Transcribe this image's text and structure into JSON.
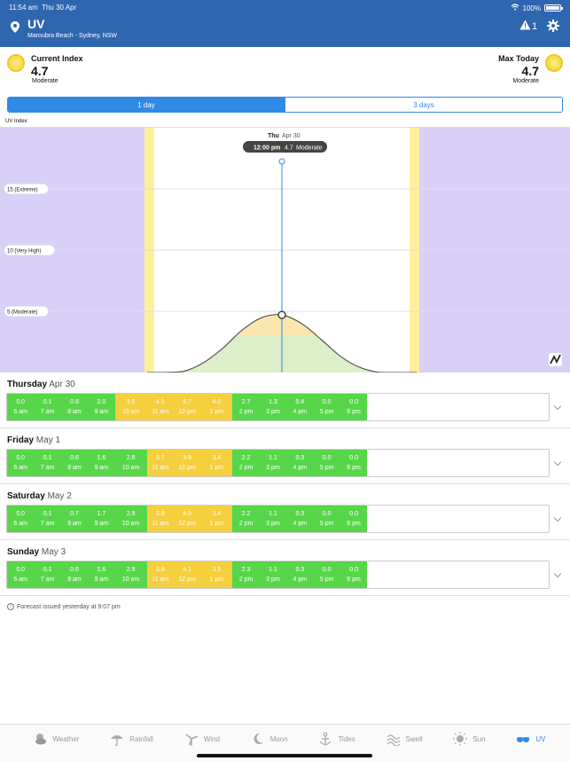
{
  "status": {
    "time": "11:54 am",
    "date": "Thu 30 Apr",
    "battery": "100%"
  },
  "header": {
    "title": "UV",
    "location": "Maroubra Beach - Sydney, NSW",
    "warning_count": "1"
  },
  "summary": {
    "current": {
      "label": "Current Index",
      "value": "4.7",
      "category": "Moderate"
    },
    "max": {
      "label": "Max Today",
      "value": "4.7",
      "category": "Moderate"
    }
  },
  "segments": [
    "1 day",
    "3 days"
  ],
  "chart_data": {
    "type": "area",
    "ylabel": "UV Index",
    "thresholds": [
      {
        "label": "15 (Extreme)",
        "value": 15
      },
      {
        "label": "10 (Very High)",
        "value": 10
      },
      {
        "label": "5 (Moderate)",
        "value": 5
      }
    ],
    "tooltip": {
      "day": "Thu",
      "date": "Apr 30",
      "time": "12:00 pm",
      "value": "4.7",
      "category": "Moderate"
    },
    "ylim": [
      0,
      20
    ],
    "x": [
      6,
      7,
      8,
      9,
      10,
      11,
      12,
      13,
      14,
      15,
      16,
      17,
      18
    ],
    "values": [
      0.0,
      0.1,
      0.8,
      2.0,
      3.5,
      4.5,
      4.7,
      4.0,
      2.7,
      1.3,
      0.4,
      0.0,
      0.0
    ],
    "colors": {
      "night": "#d8d0f7",
      "twilight": "#fef09a",
      "low_fill": "#dcefc8",
      "moderate_fill": "#fbe6b0",
      "line": "#555555",
      "marker": "#2f8ae6"
    }
  },
  "days": [
    {
      "weekday": "Thursday",
      "date": "Apr 30",
      "hours": [
        {
          "v": "0.0",
          "t": "6 am"
        },
        {
          "v": "0.1",
          "t": "7 am"
        },
        {
          "v": "0.8",
          "t": "8 am"
        },
        {
          "v": "2.0",
          "t": "9 am"
        },
        {
          "v": "3.5",
          "t": "10 am"
        },
        {
          "v": "4.5",
          "t": "11 am"
        },
        {
          "v": "4.7",
          "t": "12 pm"
        },
        {
          "v": "4.0",
          "t": "1 pm"
        },
        {
          "v": "2.7",
          "t": "2 pm"
        },
        {
          "v": "1.3",
          "t": "3 pm"
        },
        {
          "v": "0.4",
          "t": "4 pm"
        },
        {
          "v": "0.0",
          "t": "5 pm"
        },
        {
          "v": "0.0",
          "t": "6 pm"
        }
      ]
    },
    {
      "weekday": "Friday",
      "date": "May 1",
      "hours": [
        {
          "v": "0.0",
          "t": "6 am"
        },
        {
          "v": "0.1",
          "t": "7 am"
        },
        {
          "v": "0.6",
          "t": "8 am"
        },
        {
          "v": "1.6",
          "t": "9 am"
        },
        {
          "v": "2.8",
          "t": "10 am"
        },
        {
          "v": "3.7",
          "t": "11 am"
        },
        {
          "v": "3.9",
          "t": "12 pm"
        },
        {
          "v": "3.4",
          "t": "1 pm"
        },
        {
          "v": "2.2",
          "t": "2 pm"
        },
        {
          "v": "1.1",
          "t": "3 pm"
        },
        {
          "v": "0.3",
          "t": "4 pm"
        },
        {
          "v": "0.0",
          "t": "5 pm"
        },
        {
          "v": "0.0",
          "t": "6 pm"
        }
      ]
    },
    {
      "weekday": "Saturday",
      "date": "May 2",
      "hours": [
        {
          "v": "0.0",
          "t": "6 am"
        },
        {
          "v": "0.1",
          "t": "7 am"
        },
        {
          "v": "0.7",
          "t": "8 am"
        },
        {
          "v": "1.7",
          "t": "9 am"
        },
        {
          "v": "2.9",
          "t": "10 am"
        },
        {
          "v": "3.8",
          "t": "11 am"
        },
        {
          "v": "4.0",
          "t": "12 pm"
        },
        {
          "v": "3.4",
          "t": "1 pm"
        },
        {
          "v": "2.2",
          "t": "2 pm"
        },
        {
          "v": "1.1",
          "t": "3 pm"
        },
        {
          "v": "0.3",
          "t": "4 pm"
        },
        {
          "v": "0.0",
          "t": "5 pm"
        },
        {
          "v": "0.0",
          "t": "6 pm"
        }
      ]
    },
    {
      "weekday": "Sunday",
      "date": "May 3",
      "hours": [
        {
          "v": "0.0",
          "t": "6 am"
        },
        {
          "v": "0.1",
          "t": "7 am"
        },
        {
          "v": "0.6",
          "t": "8 am"
        },
        {
          "v": "1.6",
          "t": "9 am"
        },
        {
          "v": "2.9",
          "t": "10 am"
        },
        {
          "v": "3.8",
          "t": "11 am"
        },
        {
          "v": "4.1",
          "t": "12 pm"
        },
        {
          "v": "3.5",
          "t": "1 pm"
        },
        {
          "v": "2.3",
          "t": "2 pm"
        },
        {
          "v": "1.1",
          "t": "3 pm"
        },
        {
          "v": "0.3",
          "t": "4 pm"
        },
        {
          "v": "0.0",
          "t": "5 pm"
        },
        {
          "v": "0.0",
          "t": "6 pm"
        }
      ]
    }
  ],
  "forecast_note": "Forecast issued yesterday at 9:07 pm",
  "tabs": [
    {
      "label": "Weather",
      "icon": "weather-icon"
    },
    {
      "label": "Rainfall",
      "icon": "umbrella-icon"
    },
    {
      "label": "Wind",
      "icon": "wind-turbine-icon"
    },
    {
      "label": "Moon",
      "icon": "moon-icon"
    },
    {
      "label": "Tides",
      "icon": "anchor-icon"
    },
    {
      "label": "Swell",
      "icon": "swell-icon"
    },
    {
      "label": "Sun",
      "icon": "sun-icon"
    },
    {
      "label": "UV",
      "icon": "sunglasses-icon",
      "active": true
    }
  ]
}
